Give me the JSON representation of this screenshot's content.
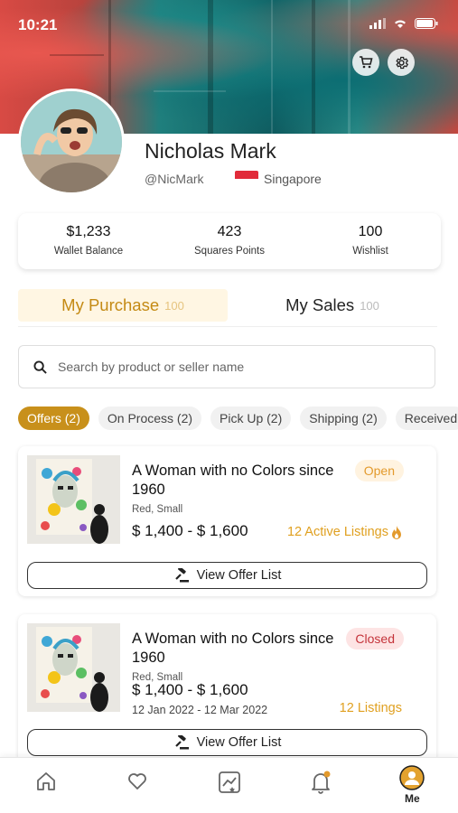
{
  "status_bar": {
    "time": "10:21"
  },
  "header": {
    "cart_icon": "cart-icon",
    "settings_icon": "gear-icon"
  },
  "profile": {
    "name": "Nicholas Mark",
    "handle": "@NicMark",
    "country": "Singapore"
  },
  "stats": [
    {
      "value": "$1,233",
      "label": "Wallet Balance"
    },
    {
      "value": "423",
      "label": "Squares Points"
    },
    {
      "value": "100",
      "label": "Wishlist"
    }
  ],
  "tabs": [
    {
      "label": "My Purchase",
      "count": "100",
      "active": true
    },
    {
      "label": "My Sales",
      "count": "100",
      "active": false
    }
  ],
  "search": {
    "placeholder": "Search by product or seller name"
  },
  "filters": [
    {
      "label": "Offers (2)",
      "active": true
    },
    {
      "label": "On Process (2)",
      "active": false
    },
    {
      "label": "Pick Up (2)",
      "active": false
    },
    {
      "label": "Shipping (2)",
      "active": false
    },
    {
      "label": "Received",
      "active": false
    }
  ],
  "cards": [
    {
      "title": "A Woman with no Colors since 1960",
      "variant": "Red, Small",
      "price": "$ 1,400 - $ 1,600",
      "status": "Open",
      "listings": "12 Active Listings",
      "dates": "",
      "button": "View Offer List"
    },
    {
      "title": "A Woman with no Colors since 1960",
      "variant": "Red, Small",
      "price": "$ 1,400 - $ 1,600",
      "status": "Closed",
      "listings": "12 Listings",
      "dates": "12 Jan 2022 - 12 Mar 2022",
      "button": "View Offer List"
    }
  ],
  "bottom_nav": {
    "items": [
      "home-icon",
      "heart-icon",
      "chart-icon",
      "bell-icon",
      "me-avatar"
    ],
    "me_label": "Me"
  },
  "colors": {
    "accent": "#c8901b",
    "open": "#e39a2c",
    "closed": "#c4333a"
  }
}
